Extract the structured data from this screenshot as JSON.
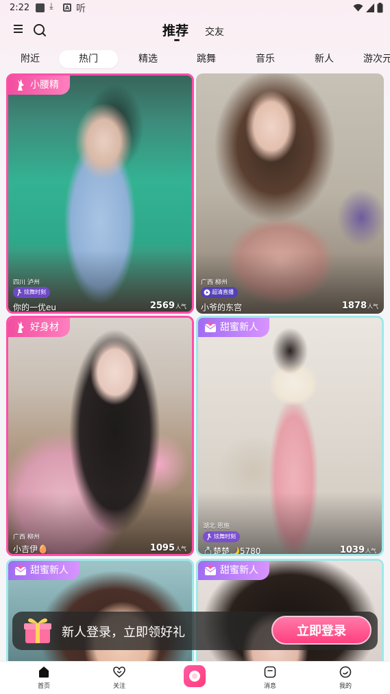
{
  "status_bar": {
    "time": "2:22",
    "icons": [
      "gallery-icon",
      "download-icon",
      "a-icon",
      "ting-icon",
      "wifi-icon",
      "signal-icon",
      "battery-icon"
    ],
    "ting_glyph": "听"
  },
  "header": {
    "active_tab": "推荐",
    "other_tab": "交友"
  },
  "categories": [
    {
      "label": "附近",
      "active": false
    },
    {
      "label": "热门",
      "active": true
    },
    {
      "label": "精选",
      "active": false
    },
    {
      "label": "跳舞",
      "active": false
    },
    {
      "label": "音乐",
      "active": false
    },
    {
      "label": "新人",
      "active": false
    },
    {
      "label": "游次元",
      "active": false
    }
  ],
  "cards": [
    {
      "badge": "小腰精",
      "badge_style": "pink",
      "location": "四川 泸州",
      "pill": "炫舞时刻",
      "name": "你的一优eu",
      "count": "2569",
      "count_unit": "人气"
    },
    {
      "badge": "",
      "badge_style": "",
      "location": "广西 柳州",
      "pill": "超清直播",
      "name": "小爷的东宫",
      "count": "1878",
      "count_unit": "人气"
    },
    {
      "badge": "好身材",
      "badge_style": "pink",
      "location": "广西 柳州",
      "pill": "",
      "name": "小吉伊🥚",
      "count": "1095",
      "count_unit": "人气"
    },
    {
      "badge": "甜蜜新人",
      "badge_style": "purple",
      "location": "湖北 恩施",
      "pill": "炫舞时刻",
      "name": "💍楚楚🌙5780",
      "count": "1039",
      "count_unit": "人气"
    },
    {
      "badge": "甜蜜新人",
      "badge_style": "purple",
      "location": "",
      "pill": "",
      "name": "",
      "count": "",
      "count_unit": ""
    },
    {
      "badge": "甜蜜新人",
      "badge_style": "purple",
      "location": "",
      "pill": "",
      "name": "",
      "count": "",
      "count_unit": ""
    }
  ],
  "banner": {
    "text": "新人登录，立即领好礼",
    "button": "立即登录"
  },
  "bottom_nav": [
    {
      "label": "首页",
      "icon": "home-icon"
    },
    {
      "label": "关注",
      "icon": "heart-icon"
    },
    {
      "label": "",
      "icon": "live-icon"
    },
    {
      "label": "消息",
      "icon": "message-icon"
    },
    {
      "label": "我的",
      "icon": "profile-icon"
    }
  ],
  "colors": {
    "accent_pink": "#ff3f7f",
    "badge_pink": "#f24ea0",
    "badge_purple": "#a06cf2"
  }
}
